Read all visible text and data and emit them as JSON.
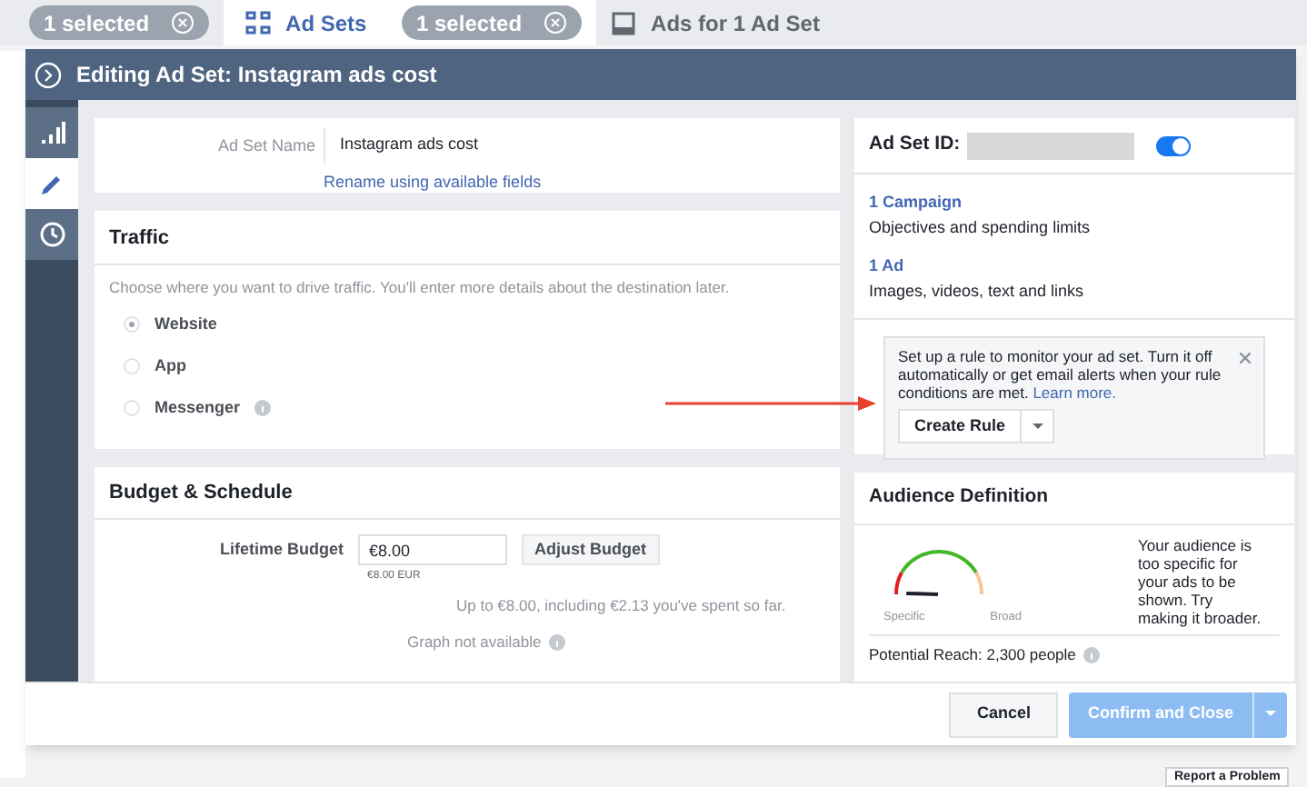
{
  "tabs": [
    {
      "pill": "1 selected",
      "selected": false
    },
    {
      "label": "Ad Sets",
      "pill": "1 selected",
      "selected": true
    },
    {
      "label": "Ads for 1 Ad Set",
      "selected": false
    }
  ],
  "dialog": {
    "title": "Editing Ad Set: Instagram ads cost",
    "rail": [
      {
        "selected": false
      },
      {
        "selected": true
      },
      {
        "selected": false
      }
    ],
    "name_section": {
      "label": "Ad Set Name",
      "value": "Instagram ads cost",
      "link": "Rename using available fields"
    },
    "traffic": {
      "title": "Traffic",
      "description": "Choose where you want to drive traffic. You'll enter more details about the destination later.",
      "options": [
        {
          "label": "Website",
          "selected": true,
          "info": false
        },
        {
          "label": "App",
          "selected": false,
          "info": false
        },
        {
          "label": "Messenger",
          "selected": false,
          "info": true
        }
      ]
    },
    "budget": {
      "title": "Budget & Schedule",
      "label": "Lifetime Budget",
      "value": "€8.00",
      "currency_note": "€8.00 EUR",
      "button": "Adjust Budget",
      "spend_note": "Up to €8.00, including €2.13 you've spent so far.",
      "graph_note": "Graph not available"
    },
    "summary": {
      "id_label": "Ad Set ID:",
      "active": true,
      "links": [
        {
          "title": "1 Campaign",
          "subtitle": "Objectives and spending limits"
        },
        {
          "title": "1 Ad",
          "subtitle": "Images, videos, text and links"
        }
      ],
      "rule_tip": {
        "text": "Set up a rule to monitor your ad set. Turn it off automatically or get email alerts when your rule conditions are met.",
        "link": "Learn more.",
        "button": "Create Rule"
      }
    },
    "audience": {
      "title": "Audience Definition",
      "low_label": "Specific",
      "high_label": "Broad",
      "message": "Your audience is too specific for your ads to be shown. Try making it broader.",
      "reach": "Potential Reach: 2,300 people"
    },
    "footer": {
      "cancel": "Cancel",
      "confirm": "Confirm and Close"
    }
  },
  "report_button": "Report a Problem"
}
